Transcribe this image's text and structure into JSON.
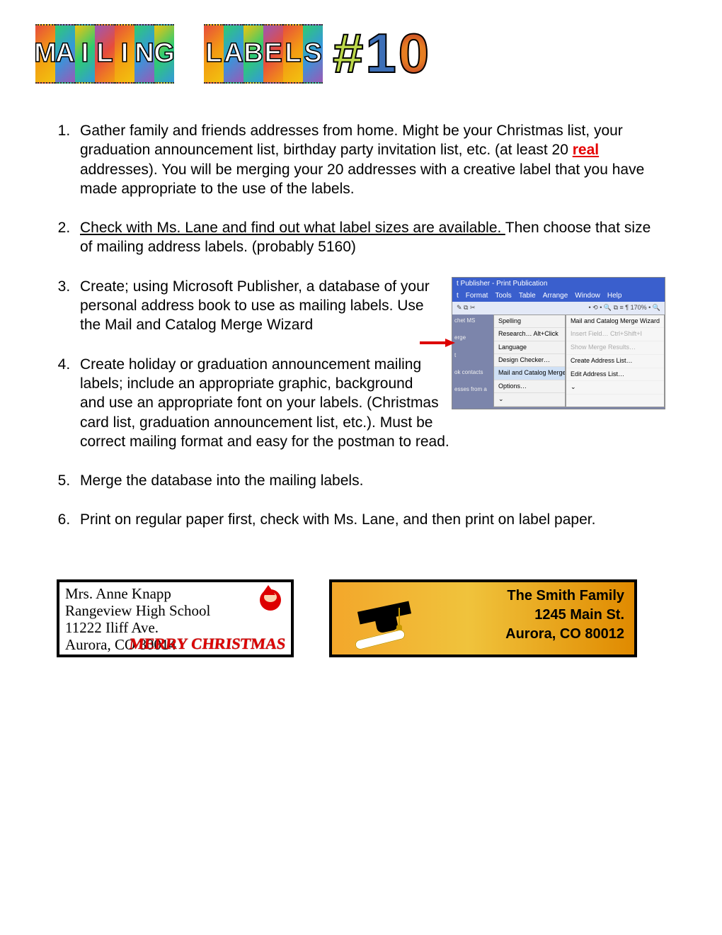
{
  "title": {
    "word1": "MAILING",
    "word2": "LABELS",
    "number": "#10"
  },
  "instructions": [
    {
      "pre": "Gather family and friends addresses from home.  Might be your Christmas list, your graduation announcement list, birthday party invitation list, etc. (at least 20 ",
      "highlight": "real",
      "post": " addresses).  You will be merging your 20 addresses with a creative label that you have made appropriate to the use of the labels."
    },
    {
      "underline": "Check with Ms. Lane and find out what label sizes are available. ",
      "rest": "Then choose that size of mailing address labels. (probably 5160)"
    },
    {
      "text": "Create; using Microsoft Publisher, a database of your personal address book to use as mailing labels. Use the Mail and Catalog Merge Wizard"
    },
    {
      "text": "Create holiday or graduation announcement mailing labels; include an appropriate graphic, background and use an appropriate font on your labels. (Christmas card list, graduation announcement list, etc.).  Must be correct mailing format and easy for the postman to read."
    },
    {
      "text": "Merge the database into the mailing labels."
    },
    {
      "text": "Print on regular paper first, check with Ms. Lane, and then print on label paper."
    }
  ],
  "publisher": {
    "title": "t Publisher - Print Publication",
    "menus": [
      "t",
      "Format",
      "Tools",
      "Table",
      "Arrange",
      "Window",
      "Help"
    ],
    "toolbar_right": "170%",
    "side_items": [
      "chet MS",
      "erge",
      "t",
      "ok contacts",
      "esses from a"
    ],
    "tools_menu": [
      "Spelling",
      "Research…    Alt+Click",
      "Language",
      "Design Checker…",
      "Mail and Catalog Merge  ▸",
      "Options…",
      "⌄"
    ],
    "submenu": [
      {
        "label": "Mail and Catalog Merge Wizard",
        "fade": false
      },
      {
        "label": "Insert Field…        Ctrl+Shift+I",
        "fade": true
      },
      {
        "label": "Show Merge Results…",
        "fade": true
      },
      {
        "label": "Create Address List…",
        "fade": false
      },
      {
        "label": "Edit Address List…",
        "fade": false
      },
      {
        "label": "⌄",
        "fade": false
      }
    ]
  },
  "label_christmas": {
    "line1": "Mrs. Anne Knapp",
    "line2": "Rangeview High School",
    "line3": "11222 Iliff Ave.",
    "line4": "Aurora, CO  80014",
    "decor": "MERRY CHRISTMAS"
  },
  "label_graduation": {
    "line1": "The Smith Family",
    "line2": "1245 Main St.",
    "line3": "Aurora, CO 80012"
  }
}
